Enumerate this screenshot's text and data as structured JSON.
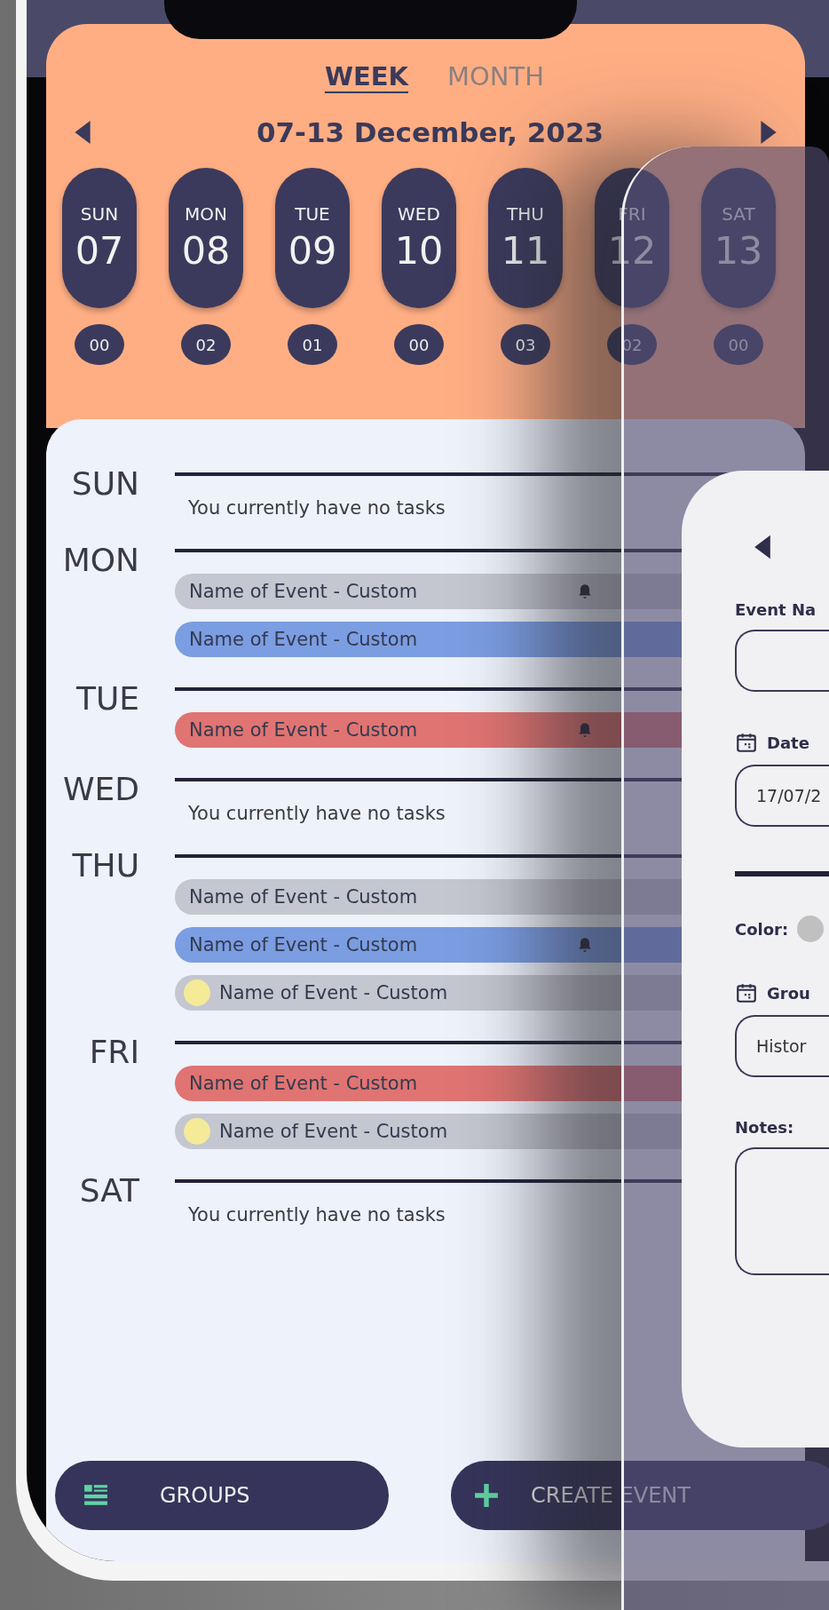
{
  "view_tabs": [
    {
      "label": "WEEK",
      "selected": true
    },
    {
      "label": "MONTH",
      "selected": false
    }
  ],
  "date_range": "07-13 December, 2023",
  "days": [
    {
      "day": "SUN",
      "date": "07",
      "count": "00"
    },
    {
      "day": "MON",
      "date": "08",
      "count": "02"
    },
    {
      "day": "TUE",
      "date": "09",
      "count": "01"
    },
    {
      "day": "WED",
      "date": "10",
      "count": "00"
    },
    {
      "day": "THU",
      "date": "11",
      "count": "03"
    },
    {
      "day": "FRI",
      "date": "12",
      "count": "02"
    },
    {
      "day": "SAT",
      "date": "13",
      "count": "00"
    }
  ],
  "schedule": [
    {
      "day": "SUN",
      "empty_text": "You currently have no tasks"
    },
    {
      "day": "MON",
      "events": [
        {
          "name": "Name of Event - Custom",
          "color": "#c4c6d0",
          "reminder": true,
          "dot": false
        },
        {
          "name": "Name of Event - Custom",
          "color": "#7b9de2",
          "reminder": false,
          "dot": false
        }
      ]
    },
    {
      "day": "TUE",
      "events": [
        {
          "name": "Name of Event - Custom",
          "color": "#e07472",
          "reminder": true,
          "dot": false
        }
      ]
    },
    {
      "day": "WED",
      "empty_text": "You currently have no tasks"
    },
    {
      "day": "THU",
      "events": [
        {
          "name": "Name of Event - Custom",
          "color": "#c4c6d0",
          "reminder": false,
          "dot": false
        },
        {
          "name": "Name of Event - Custom",
          "color": "#7b9de2",
          "reminder": true,
          "dot": false
        },
        {
          "name": "Name of Event - Custom",
          "color": "#c4c6d0",
          "reminder": false,
          "dot": true
        }
      ]
    },
    {
      "day": "FRI",
      "events": [
        {
          "name": "Name of Event - Custom",
          "color": "#e07472",
          "reminder": false,
          "dot": false
        },
        {
          "name": "Name of Event - Custom",
          "color": "#c4c6d0",
          "reminder": false,
          "dot": true
        }
      ]
    },
    {
      "day": "SAT",
      "empty_text": "You currently have no tasks"
    }
  ],
  "buttons": [
    {
      "kind": "groups",
      "label": "GROUPS"
    },
    {
      "kind": "create",
      "label": "CREATE EVENT"
    }
  ],
  "event_form": {
    "name_label": "Event Na",
    "date_label": "Date",
    "date_value": "17/07/2",
    "color_label": "Color:",
    "group_label": "Grou",
    "group_value": "Histor",
    "notes_label": "Notes:"
  }
}
